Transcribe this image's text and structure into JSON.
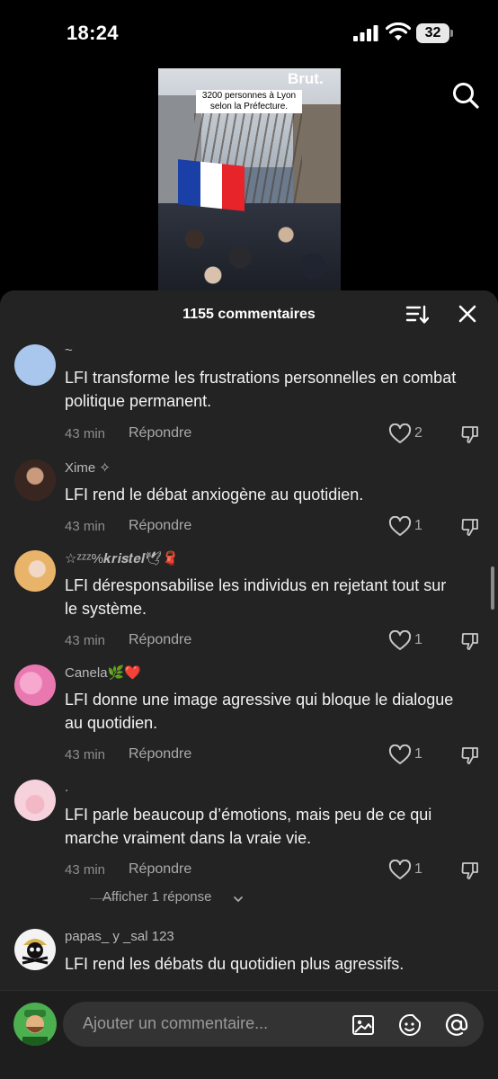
{
  "status_bar": {
    "time": "18:24",
    "battery": "32"
  },
  "video": {
    "brand": "Brut.",
    "caption": "3200 personnes à Lyon selon la Préfecture.",
    "flag_colors": [
      "#1a3fa6",
      "#ffffff",
      "#e8242b"
    ]
  },
  "header": {
    "comment_count": "1155 commentaires"
  },
  "comments": [
    {
      "username": "~",
      "text": "LFI transforme les frustrations personnelles en combat politique permanent.",
      "time": "43 min",
      "reply": "Répondre",
      "likes": "2",
      "avatar_color": "#a9c6ec"
    },
    {
      "username": "Xime ✧",
      "text": "LFI rend le débat anxiogène au quotidien.",
      "time": "43 min",
      "reply": "Répondre",
      "likes": "1",
      "avatar_color": "#5a3a2e"
    },
    {
      "username": "☆ᶻᶻᶻ%𝒌𝒓𝒊𝒔𝒕𝒆𝒍🕊🧣",
      "text": "LFI déresponsabilise les individus en rejetant tout sur le système.",
      "time": "43 min",
      "reply": "Répondre",
      "likes": "1",
      "avatar_color": "#e8b46a"
    },
    {
      "username": "Canela🌿❤️",
      "text": "LFI donne une image agressive qui bloque le dialogue au quotidien.",
      "time": "43 min",
      "reply": "Répondre",
      "likes": "1",
      "avatar_color": "#e978b1"
    },
    {
      "username": ".",
      "text": "LFI parle beaucoup d’émotions, mais peu de ce qui marche vraiment dans la vraie vie.",
      "time": "43 min",
      "reply": "Répondre",
      "likes": "1",
      "avatar_color": "#f6d2dc"
    },
    {
      "username": "papas_ y _sal 123",
      "text": "LFI rend les débats du quotidien plus agressifs.",
      "avatar_color": "#f3f3f3"
    }
  ],
  "view_replies": "Afficher 1 réponse",
  "input": {
    "placeholder": "Ajouter un commentaire..."
  },
  "icons": {
    "search": "search-icon",
    "sort": "sort-icon",
    "close": "close-icon",
    "like": "heart-icon",
    "dislike": "thumbs-down-icon",
    "image": "image-icon",
    "emoji": "emoji-icon",
    "mention": "at-icon"
  }
}
